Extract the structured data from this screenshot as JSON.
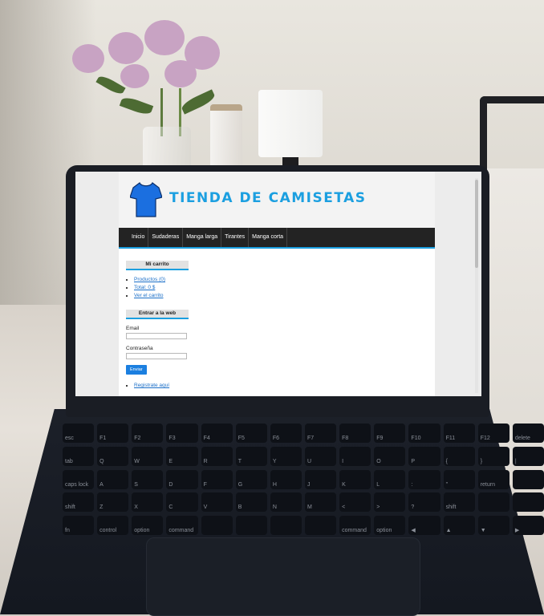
{
  "site": {
    "title": "TIENDA DE CAMISETAS",
    "logo_icon": "tshirt-icon",
    "accent_color": "#1b9fe0"
  },
  "nav": {
    "items": [
      "Inicio",
      "Sudaderas",
      "Manga larga",
      "Tirantes",
      "Manga corta"
    ]
  },
  "cart": {
    "title": "Mi carrito",
    "products": "Productos (0)",
    "total": "Total: 0 $",
    "view": "Ver el carrito"
  },
  "login": {
    "title": "Entrar a la web",
    "email_label": "Email",
    "password_label": "Contraseña",
    "submit": "Enviar",
    "register": "Registrate aquí"
  },
  "keyboard": {
    "keys": [
      "esc",
      "F1",
      "F2",
      "F3",
      "F4",
      "F5",
      "F6",
      "F7",
      "F8",
      "F9",
      "F10",
      "F11",
      "F12",
      "delete",
      "tab",
      "Q",
      "W",
      "E",
      "R",
      "T",
      "Y",
      "U",
      "I",
      "O",
      "P",
      "{",
      "}",
      "|",
      "caps lock",
      "A",
      "S",
      "D",
      "F",
      "G",
      "H",
      "J",
      "K",
      "L",
      ":",
      "\"",
      "return",
      "",
      "shift",
      "Z",
      "X",
      "C",
      "V",
      "B",
      "N",
      "M",
      "<",
      ">",
      "?",
      "shift",
      "",
      "",
      "fn",
      "control",
      "option",
      "command",
      "",
      "",
      "",
      "",
      "command",
      "option",
      "◀",
      "▲",
      "▼",
      "▶"
    ]
  }
}
